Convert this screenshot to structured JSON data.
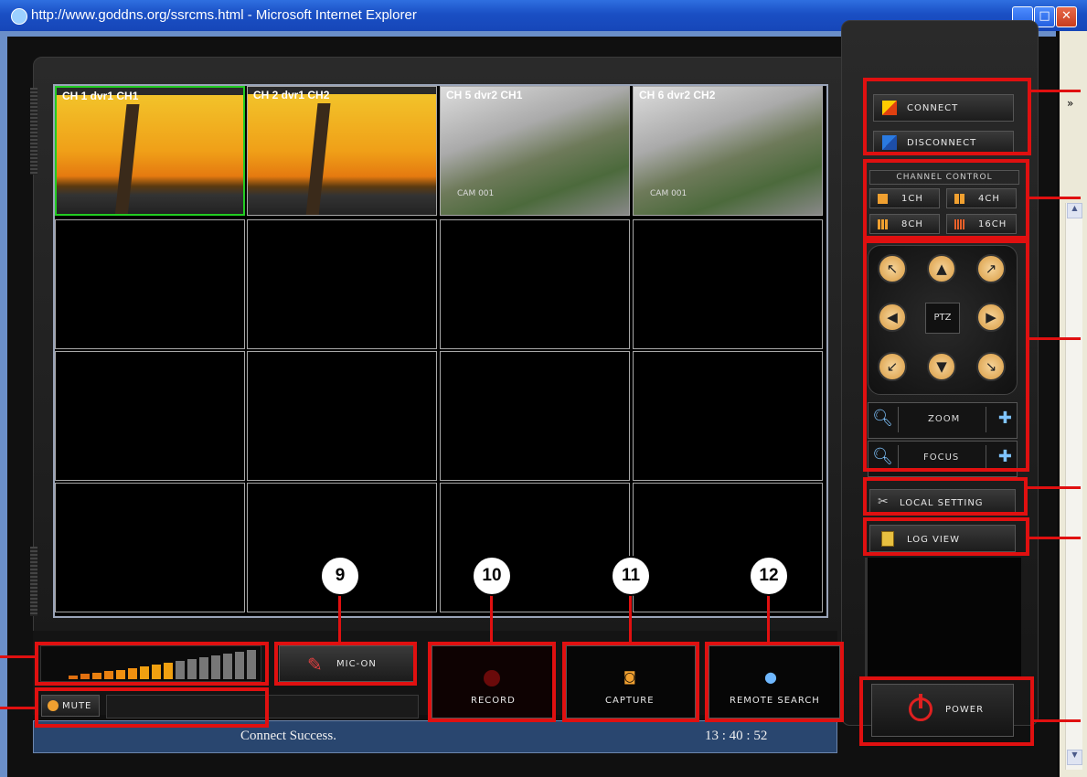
{
  "window": {
    "title": "http://www.goddns.org/ssrcms.html - Microsoft Internet Explorer"
  },
  "channels": [
    {
      "label": "CH 1 dvr1 CH1",
      "cam": ""
    },
    {
      "label": "CH 2 dvr1 CH2",
      "cam": ""
    },
    {
      "label": "CH 5 dvr2 CH1",
      "cam": "CAM 001"
    },
    {
      "label": "CH 6 dvr2 CH2",
      "cam": "CAM 001"
    }
  ],
  "side": {
    "connect": "CONNECT",
    "disconnect": "DISCONNECT",
    "channel_control": "CHANNEL CONTROL",
    "ch1": "1CH",
    "ch4": "4CH",
    "ch8": "8CH",
    "ch16": "16CH",
    "ptz": "PTZ",
    "zoom": "ZOOM",
    "focus": "FOCUS",
    "local_setting": "LOCAL SETTING",
    "log_view": "LOG VIEW",
    "power": "POWER"
  },
  "bottom": {
    "mic": "MIC-ON",
    "mute": "MUTE",
    "record": "RECORD",
    "capture": "CAPTURE",
    "remote_search": "REMOTE SEARCH"
  },
  "callouts": [
    "9",
    "10",
    "11",
    "12"
  ],
  "status": {
    "message": "Connect Success.",
    "time": "13 : 40 : 52"
  },
  "colors": {
    "highlight": "#e01010",
    "selected_cell": "#22cc22",
    "status_bar": "#29466f"
  }
}
